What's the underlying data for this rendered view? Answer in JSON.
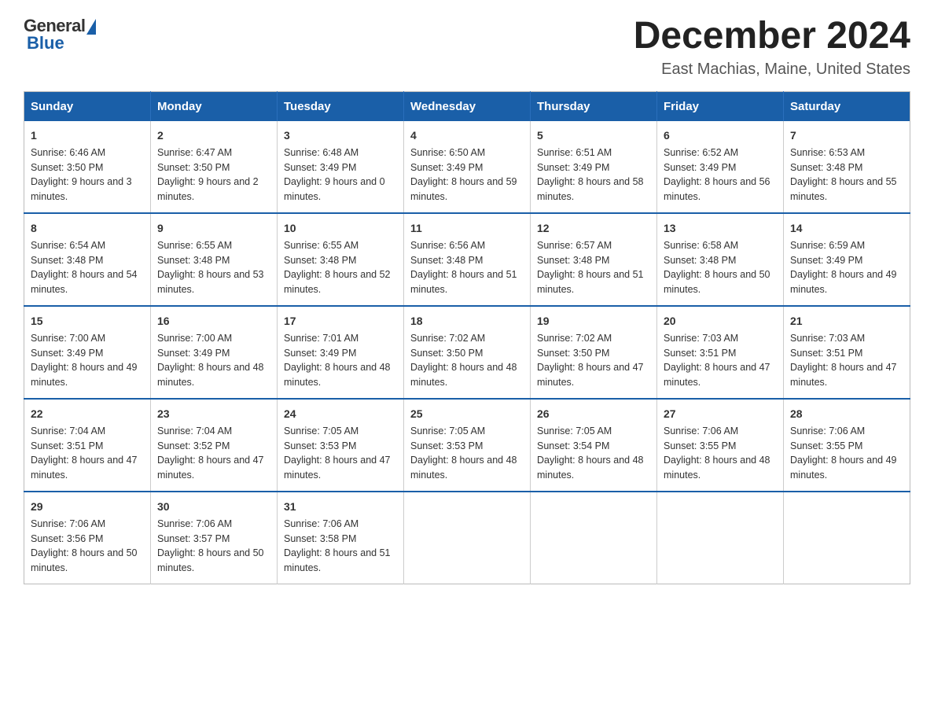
{
  "logo": {
    "general": "General",
    "blue": "Blue"
  },
  "header": {
    "title": "December 2024",
    "location": "East Machias, Maine, United States"
  },
  "weekdays": [
    "Sunday",
    "Monday",
    "Tuesday",
    "Wednesday",
    "Thursday",
    "Friday",
    "Saturday"
  ],
  "weeks": [
    [
      {
        "day": "1",
        "sunrise": "Sunrise: 6:46 AM",
        "sunset": "Sunset: 3:50 PM",
        "daylight": "Daylight: 9 hours and 3 minutes."
      },
      {
        "day": "2",
        "sunrise": "Sunrise: 6:47 AM",
        "sunset": "Sunset: 3:50 PM",
        "daylight": "Daylight: 9 hours and 2 minutes."
      },
      {
        "day": "3",
        "sunrise": "Sunrise: 6:48 AM",
        "sunset": "Sunset: 3:49 PM",
        "daylight": "Daylight: 9 hours and 0 minutes."
      },
      {
        "day": "4",
        "sunrise": "Sunrise: 6:50 AM",
        "sunset": "Sunset: 3:49 PM",
        "daylight": "Daylight: 8 hours and 59 minutes."
      },
      {
        "day": "5",
        "sunrise": "Sunrise: 6:51 AM",
        "sunset": "Sunset: 3:49 PM",
        "daylight": "Daylight: 8 hours and 58 minutes."
      },
      {
        "day": "6",
        "sunrise": "Sunrise: 6:52 AM",
        "sunset": "Sunset: 3:49 PM",
        "daylight": "Daylight: 8 hours and 56 minutes."
      },
      {
        "day": "7",
        "sunrise": "Sunrise: 6:53 AM",
        "sunset": "Sunset: 3:48 PM",
        "daylight": "Daylight: 8 hours and 55 minutes."
      }
    ],
    [
      {
        "day": "8",
        "sunrise": "Sunrise: 6:54 AM",
        "sunset": "Sunset: 3:48 PM",
        "daylight": "Daylight: 8 hours and 54 minutes."
      },
      {
        "day": "9",
        "sunrise": "Sunrise: 6:55 AM",
        "sunset": "Sunset: 3:48 PM",
        "daylight": "Daylight: 8 hours and 53 minutes."
      },
      {
        "day": "10",
        "sunrise": "Sunrise: 6:55 AM",
        "sunset": "Sunset: 3:48 PM",
        "daylight": "Daylight: 8 hours and 52 minutes."
      },
      {
        "day": "11",
        "sunrise": "Sunrise: 6:56 AM",
        "sunset": "Sunset: 3:48 PM",
        "daylight": "Daylight: 8 hours and 51 minutes."
      },
      {
        "day": "12",
        "sunrise": "Sunrise: 6:57 AM",
        "sunset": "Sunset: 3:48 PM",
        "daylight": "Daylight: 8 hours and 51 minutes."
      },
      {
        "day": "13",
        "sunrise": "Sunrise: 6:58 AM",
        "sunset": "Sunset: 3:48 PM",
        "daylight": "Daylight: 8 hours and 50 minutes."
      },
      {
        "day": "14",
        "sunrise": "Sunrise: 6:59 AM",
        "sunset": "Sunset: 3:49 PM",
        "daylight": "Daylight: 8 hours and 49 minutes."
      }
    ],
    [
      {
        "day": "15",
        "sunrise": "Sunrise: 7:00 AM",
        "sunset": "Sunset: 3:49 PM",
        "daylight": "Daylight: 8 hours and 49 minutes."
      },
      {
        "day": "16",
        "sunrise": "Sunrise: 7:00 AM",
        "sunset": "Sunset: 3:49 PM",
        "daylight": "Daylight: 8 hours and 48 minutes."
      },
      {
        "day": "17",
        "sunrise": "Sunrise: 7:01 AM",
        "sunset": "Sunset: 3:49 PM",
        "daylight": "Daylight: 8 hours and 48 minutes."
      },
      {
        "day": "18",
        "sunrise": "Sunrise: 7:02 AM",
        "sunset": "Sunset: 3:50 PM",
        "daylight": "Daylight: 8 hours and 48 minutes."
      },
      {
        "day": "19",
        "sunrise": "Sunrise: 7:02 AM",
        "sunset": "Sunset: 3:50 PM",
        "daylight": "Daylight: 8 hours and 47 minutes."
      },
      {
        "day": "20",
        "sunrise": "Sunrise: 7:03 AM",
        "sunset": "Sunset: 3:51 PM",
        "daylight": "Daylight: 8 hours and 47 minutes."
      },
      {
        "day": "21",
        "sunrise": "Sunrise: 7:03 AM",
        "sunset": "Sunset: 3:51 PM",
        "daylight": "Daylight: 8 hours and 47 minutes."
      }
    ],
    [
      {
        "day": "22",
        "sunrise": "Sunrise: 7:04 AM",
        "sunset": "Sunset: 3:51 PM",
        "daylight": "Daylight: 8 hours and 47 minutes."
      },
      {
        "day": "23",
        "sunrise": "Sunrise: 7:04 AM",
        "sunset": "Sunset: 3:52 PM",
        "daylight": "Daylight: 8 hours and 47 minutes."
      },
      {
        "day": "24",
        "sunrise": "Sunrise: 7:05 AM",
        "sunset": "Sunset: 3:53 PM",
        "daylight": "Daylight: 8 hours and 47 minutes."
      },
      {
        "day": "25",
        "sunrise": "Sunrise: 7:05 AM",
        "sunset": "Sunset: 3:53 PM",
        "daylight": "Daylight: 8 hours and 48 minutes."
      },
      {
        "day": "26",
        "sunrise": "Sunrise: 7:05 AM",
        "sunset": "Sunset: 3:54 PM",
        "daylight": "Daylight: 8 hours and 48 minutes."
      },
      {
        "day": "27",
        "sunrise": "Sunrise: 7:06 AM",
        "sunset": "Sunset: 3:55 PM",
        "daylight": "Daylight: 8 hours and 48 minutes."
      },
      {
        "day": "28",
        "sunrise": "Sunrise: 7:06 AM",
        "sunset": "Sunset: 3:55 PM",
        "daylight": "Daylight: 8 hours and 49 minutes."
      }
    ],
    [
      {
        "day": "29",
        "sunrise": "Sunrise: 7:06 AM",
        "sunset": "Sunset: 3:56 PM",
        "daylight": "Daylight: 8 hours and 50 minutes."
      },
      {
        "day": "30",
        "sunrise": "Sunrise: 7:06 AM",
        "sunset": "Sunset: 3:57 PM",
        "daylight": "Daylight: 8 hours and 50 minutes."
      },
      {
        "day": "31",
        "sunrise": "Sunrise: 7:06 AM",
        "sunset": "Sunset: 3:58 PM",
        "daylight": "Daylight: 8 hours and 51 minutes."
      },
      null,
      null,
      null,
      null
    ]
  ]
}
